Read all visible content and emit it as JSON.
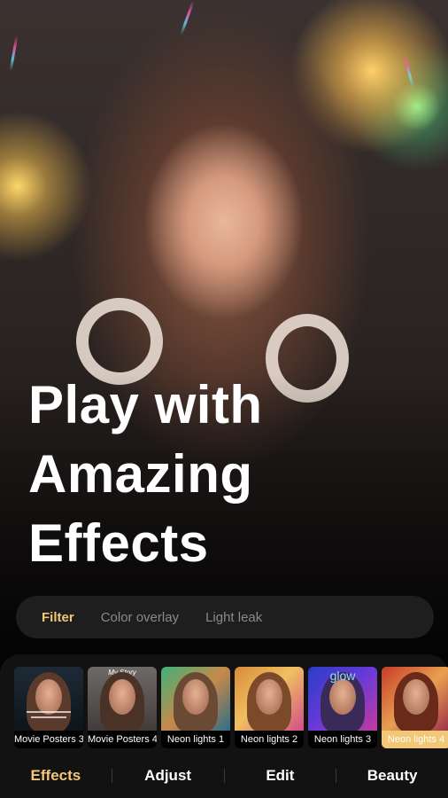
{
  "headline": {
    "line1": "Play with",
    "line2": "Amazing",
    "line3": "Effects"
  },
  "categories": [
    {
      "label": "Filter",
      "active": true
    },
    {
      "label": "Color overlay",
      "active": false
    },
    {
      "label": "Light leak",
      "active": false
    }
  ],
  "filters": [
    {
      "label": "Movie Posters 3",
      "poster_text": ""
    },
    {
      "label": "Movie Posters 4",
      "poster_text": "My Story"
    },
    {
      "label": "Neon lights 1"
    },
    {
      "label": "Neon lights 2"
    },
    {
      "label": "Neon lights 3",
      "overlay_text": "glow"
    },
    {
      "label": "Neon lights 4",
      "selected": true
    }
  ],
  "bottom_nav": [
    {
      "label": "Effects",
      "active": true
    },
    {
      "label": "Adjust",
      "active": false
    },
    {
      "label": "Edit",
      "active": false
    },
    {
      "label": "Beauty",
      "active": false
    }
  ],
  "colors": {
    "accent": "#f2c776",
    "background": "#000000",
    "panel": "#121212",
    "category_bar": "#1e1e1e"
  }
}
